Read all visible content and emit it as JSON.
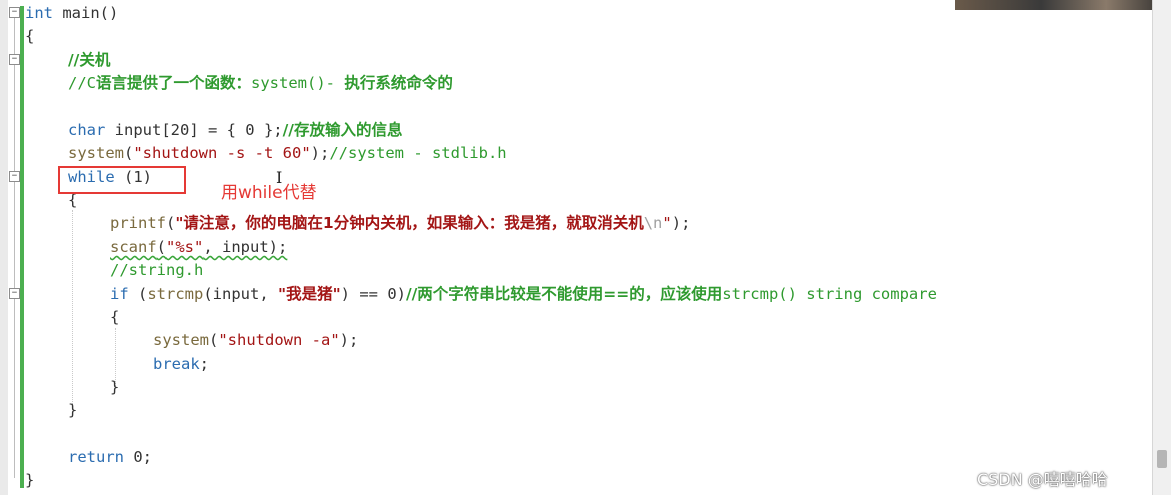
{
  "code": {
    "l1_type": "int",
    "l1_rest": " main()",
    "l2": "{",
    "l3": "//关机",
    "l4_prefix": "//C",
    "l4_cjk": "语言提供了一个函数：",
    "l4_code": "system()- ",
    "l4_tail": "执行系统命令的",
    "l6_type": "char",
    "l6_rest": " input[20] = { 0 };",
    "l6_cmt": "//存放输入的信息",
    "l7_fn": "system",
    "l7_open": "(",
    "l7_str": "\"shutdown -s -t 60\"",
    "l7_close": ");",
    "l7_cmt": "//system - stdlib.h",
    "l8_kw": "while",
    "l8_rest": " (1)",
    "l9": "{",
    "l10_fn": "printf",
    "l10_open": "(",
    "l10_str": "\"请注意，你的电脑在1分钟内关机，如果输入：我是猪，就取消关机",
    "l10_esc": "\\n",
    "l10_strend": "\"",
    "l10_close": ");",
    "l11_fn": "scanf",
    "l11_open": "(",
    "l11_str": "\"%s\"",
    "l11_rest": ", input);",
    "l12": "//string.h",
    "l13_kw": "if",
    "l13_a": " (",
    "l13_fn": "strcmp",
    "l13_b": "(input, ",
    "l13_str": "\"我是猪\"",
    "l13_c": ") == 0)",
    "l13_cmt1": "//两个字符串比较是不能使用==的，应该使用",
    "l13_cmt2": "strcmp() string compare",
    "l14": "{",
    "l15_fn": "system",
    "l15_open": "(",
    "l15_str": "\"shutdown -a\"",
    "l15_close": ");",
    "l16_kw": "break",
    "l16_rest": ";",
    "l17": "}",
    "l18": "}",
    "l20_kw": "return",
    "l20_rest": " 0;",
    "l21": "}"
  },
  "annotation": "用while代替",
  "watermark": "CSDN @嘻嘻哈哈",
  "colors": {
    "keyword": "#2b6cb0",
    "string": "#a31515",
    "comment": "#2f9a2f",
    "highlight_box": "#e53935",
    "change_bar": "#4caf50"
  }
}
